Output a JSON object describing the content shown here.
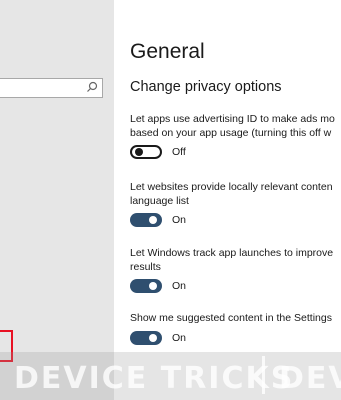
{
  "search": {
    "placeholder": ""
  },
  "page": {
    "title": "General",
    "section": "Change privacy options"
  },
  "settings": [
    {
      "line1": "Let apps use advertising ID to make ads mo",
      "line2": "based on your app usage (turning this off w",
      "state": "Off",
      "on": false
    },
    {
      "line1": "Let websites provide locally relevant conten",
      "line2": "language list",
      "state": "On",
      "on": true
    },
    {
      "line1": "Let Windows track app launches to improve",
      "line2": "results",
      "state": "On",
      "on": true
    },
    {
      "line1": "Show me suggested content in the Settings",
      "line2": "",
      "state": "On",
      "on": true
    }
  ],
  "watermark": {
    "text": "DEVICE TRICKS",
    "text2": "DEV"
  },
  "colors": {
    "toggle_on": "#2f4f6f",
    "highlight": "#e81123",
    "sidebar": "#e6e6e6"
  }
}
